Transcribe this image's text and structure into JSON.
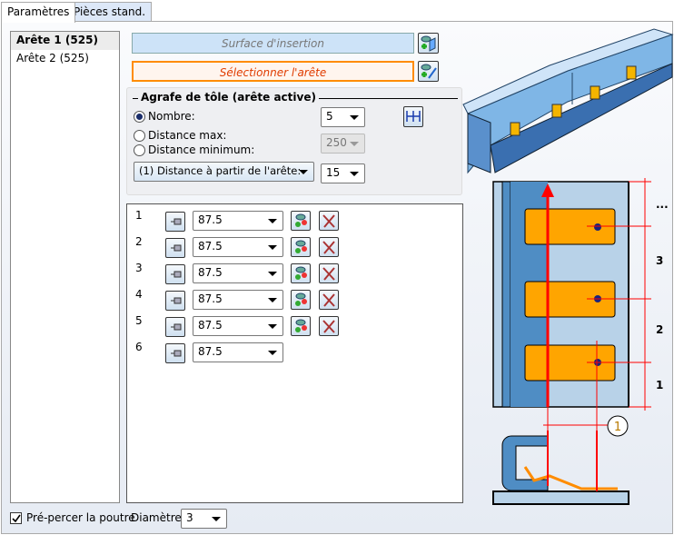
{
  "tabs": [
    {
      "label": "Paramètres",
      "active": true
    },
    {
      "label": "Pièces stand."
    }
  ],
  "edges": [
    {
      "label": "Arête 1 (525)",
      "selected": true
    },
    {
      "label": "Arête 2 (525)"
    }
  ],
  "buttons": {
    "surface": "Surface d'insertion",
    "select_edge": "Sélectionner l'arête"
  },
  "group": {
    "title": "Agrafe de tôle (arête active)",
    "nombre_label": "Nombre:",
    "nombre_value": "5",
    "dist_max_label": "Distance max:",
    "dist_min_label": "Distance minimum:",
    "dist_value": "250",
    "mode_value": "(1) Distance à partir de l'arête:",
    "mode_distance": "15",
    "selected_option": "Nombre"
  },
  "rows": [
    {
      "index": "1",
      "value": "87.5",
      "actions": true
    },
    {
      "index": "2",
      "value": "87.5",
      "actions": true
    },
    {
      "index": "3",
      "value": "87.5",
      "actions": true
    },
    {
      "index": "4",
      "value": "87.5",
      "actions": true
    },
    {
      "index": "5",
      "value": "87.5",
      "actions": true
    },
    {
      "index": "6",
      "value": "87.5",
      "actions": false
    }
  ],
  "bottom": {
    "prepierce_label": "Pré-percer la poutre",
    "prepierce_checked": true,
    "diameter_label": "Diamètre:",
    "diameter_value": "3"
  },
  "diagram": {
    "labels": [
      "...",
      "3",
      "2",
      "1"
    ],
    "callout": "1"
  },
  "colors": {
    "accent_orange": "#ff8c00",
    "clip": "#ffa500",
    "red": "#ff0000",
    "blue": "#4f8dc4"
  }
}
